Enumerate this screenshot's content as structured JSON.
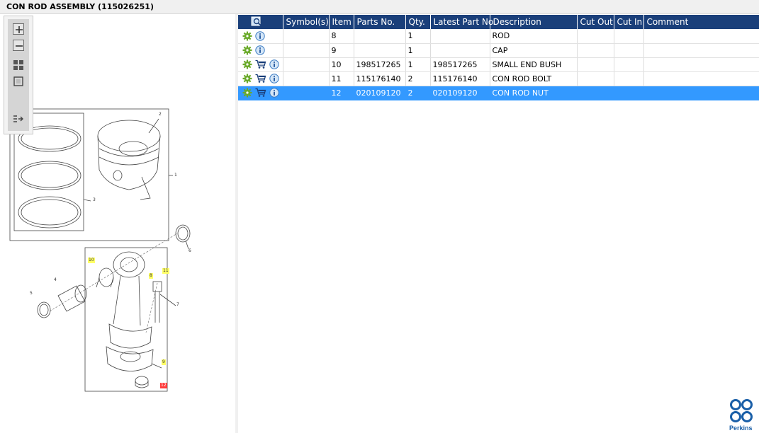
{
  "window": {
    "title": "CON ROD ASSEMBLY (115026251)"
  },
  "toolbar": {
    "buttons": [
      {
        "icon": "zoom-in-icon"
      },
      {
        "icon": "zoom-out-icon"
      },
      {
        "icon": "fit-all-icon"
      },
      {
        "icon": "actual-size-icon"
      },
      {
        "icon": "toggle-pane-icon"
      }
    ]
  },
  "drawing": {
    "callouts": [
      "2",
      "1",
      "3",
      "6",
      "10",
      "8",
      "11",
      "4",
      "5",
      "7",
      "9",
      "12"
    ]
  },
  "table": {
    "columns": [
      "",
      "Symbol(s)",
      "Item",
      "Parts No.",
      "Qty.",
      "Latest Part No.",
      "Description",
      "Cut Out",
      "Cut In",
      "Comment"
    ],
    "rows": [
      {
        "item": "8",
        "parts_no": "",
        "qty": "1",
        "latest": "",
        "desc": "ROD",
        "cart": false,
        "selected": false
      },
      {
        "item": "9",
        "parts_no": "",
        "qty": "1",
        "latest": "",
        "desc": "CAP",
        "cart": false,
        "selected": false
      },
      {
        "item": "10",
        "parts_no": "198517265",
        "qty": "1",
        "latest": "198517265",
        "desc": "SMALL END BUSH",
        "cart": true,
        "selected": false
      },
      {
        "item": "11",
        "parts_no": "115176140",
        "qty": "2",
        "latest": "115176140",
        "desc": "CON ROD BOLT",
        "cart": true,
        "selected": false
      },
      {
        "item": "12",
        "parts_no": "020109120",
        "qty": "2",
        "latest": "020109120",
        "desc": "CON ROD NUT",
        "cart": true,
        "selected": true
      }
    ]
  },
  "brand": {
    "name": "Perkins"
  },
  "colors": {
    "header": "#1a3f7a",
    "selection": "#3399ff",
    "highlight": "#ffff66",
    "brand": "#1a5fa8"
  }
}
